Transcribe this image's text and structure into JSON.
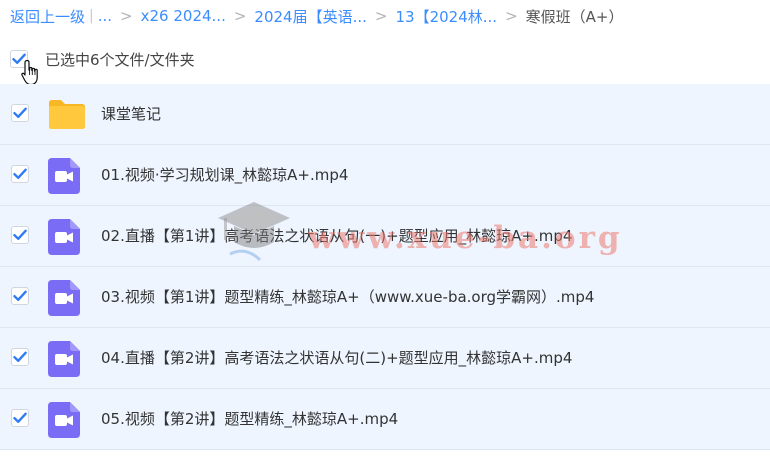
{
  "breadcrumb": {
    "back": "返回上一级",
    "ellipsis": "...",
    "items": [
      "x26 2024...",
      "2024届【英语...",
      "13【2024林..."
    ],
    "current": "寒假班（A+）"
  },
  "selection": {
    "text": "已选中6个文件/文件夹"
  },
  "files": [
    {
      "name": "课堂笔记",
      "type": "folder"
    },
    {
      "name": "01.视频·学习规划课_林懿琼A+.mp4",
      "type": "video"
    },
    {
      "name": "02.直播【第1讲】高考语法之状语从句(一)+题型应用_林懿琼A+.mp4",
      "type": "video"
    },
    {
      "name": "03.视频【第1讲】题型精练_林懿琼A+（www.xue-ba.org学霸网）.mp4",
      "type": "video"
    },
    {
      "name": "04.直播【第2讲】高考语法之状语从句(二)+题型应用_林懿琼A+.mp4",
      "type": "video"
    },
    {
      "name": "05.视频【第2讲】题型精练_林懿琼A+.mp4",
      "type": "video"
    }
  ],
  "watermark": {
    "text": "www.xue-ba.org"
  },
  "colors": {
    "accent": "#3b8cff",
    "row_bg": "#eef5ff",
    "video_icon": "#7b6cf6",
    "folder_icon": "#ffc83d",
    "check": "#2f7bf5"
  },
  "icons": {
    "checkbox": "checkmark-icon",
    "folder": "folder-icon",
    "video": "video-file-icon",
    "cursor": "hand-pointer-icon"
  }
}
